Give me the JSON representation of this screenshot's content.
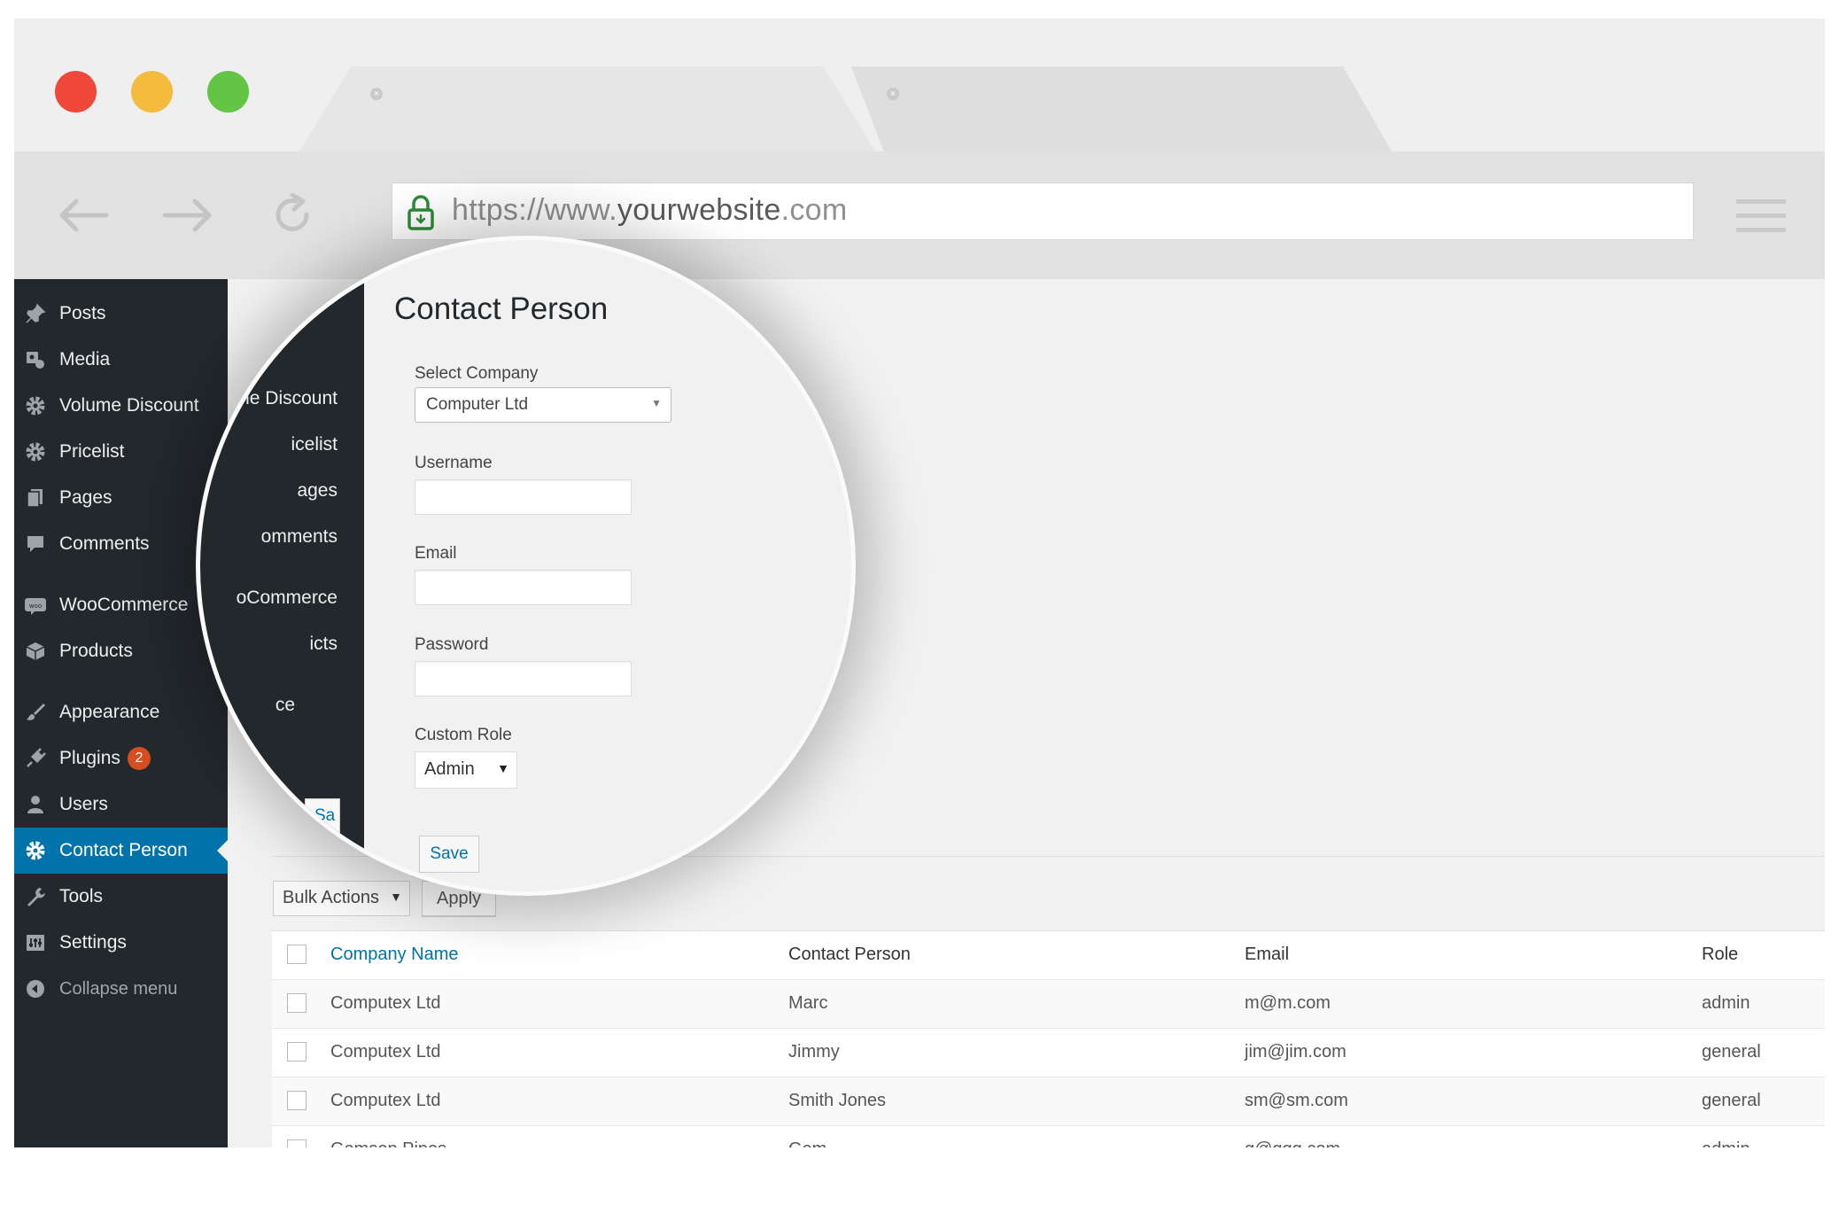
{
  "browser": {
    "url_prefix": "https://www.",
    "url_domain": "yourwebsite",
    "url_suffix": ".com",
    "tab_close_glyph": "×"
  },
  "sidebar": {
    "items": [
      {
        "label": "Posts",
        "icon": "pushpin-icon"
      },
      {
        "label": "Media",
        "icon": "media-icon"
      },
      {
        "label": "Volume Discount",
        "icon": "gear-icon"
      },
      {
        "label": "Pricelist",
        "icon": "gear-icon"
      },
      {
        "label": "Pages",
        "icon": "pages-icon"
      },
      {
        "label": "Comments",
        "icon": "comment-icon"
      },
      {
        "label": "WooCommerce",
        "icon": "woo-icon"
      },
      {
        "label": "Products",
        "icon": "box-icon"
      },
      {
        "label": "Appearance",
        "icon": "brush-icon"
      },
      {
        "label": "Plugins",
        "icon": "plug-icon",
        "badge": "2"
      },
      {
        "label": "Users",
        "icon": "user-icon"
      },
      {
        "label": "Contact Person",
        "icon": "gear-icon",
        "active": true
      },
      {
        "label": "Tools",
        "icon": "wrench-icon"
      },
      {
        "label": "Settings",
        "icon": "settings-icon"
      },
      {
        "label": "Collapse menu",
        "icon": "collapse-icon"
      }
    ]
  },
  "magnifier": {
    "sidebar_fragments": [
      "ume Discount",
      "icelist",
      "ages",
      "omments",
      "oCommerce",
      "icts",
      "ce"
    ],
    "ghost_button": "Sa",
    "form": {
      "title": "Contact Person",
      "company_label": "Select Company",
      "company_value": "Computer Ltd",
      "username_label": "Username",
      "email_label": "Email",
      "password_label": "Password",
      "role_label": "Custom Role",
      "role_value": "Admin",
      "save_label": "Save"
    }
  },
  "list": {
    "bulk_actions": "Bulk Actions",
    "apply": "Apply",
    "columns": [
      "Company Name",
      "Contact Person",
      "Email",
      "Role"
    ],
    "rows": [
      [
        "Computex Ltd",
        "Marc",
        "m@m.com",
        "admin"
      ],
      [
        "Computex Ltd",
        "Jimmy",
        "jim@jim.com",
        "general"
      ],
      [
        "Computex Ltd",
        "Smith Jones",
        "sm@sm.com",
        "general"
      ],
      [
        "Gemson Pipes",
        "Gem",
        "g@ggg.com",
        "admin"
      ]
    ]
  },
  "colors": {
    "admin_sidebar": "#23282d",
    "active_blue": "#0073aa",
    "badge_orange": "#d54e21",
    "traffic_red": "#ef473a",
    "traffic_yellow": "#f4bb3c",
    "traffic_green": "#62c543"
  }
}
